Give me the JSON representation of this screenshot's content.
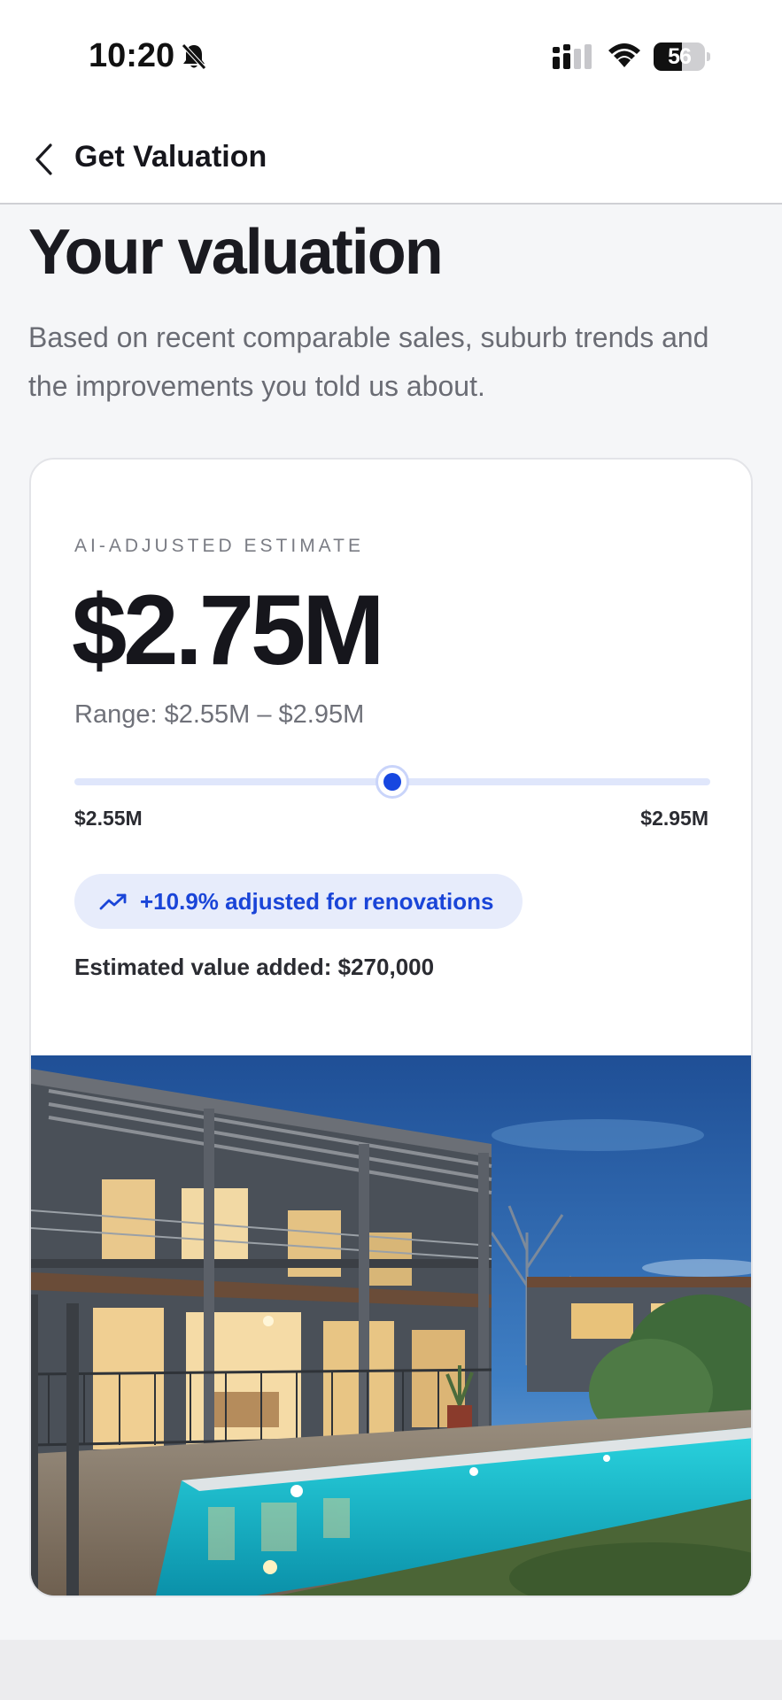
{
  "status_bar": {
    "time": "10:20",
    "battery_level": 56,
    "battery_text": "56",
    "icons": [
      "bell-slash-icon",
      "signal-icon",
      "wifi-icon",
      "battery-icon"
    ]
  },
  "nav": {
    "title": "Get Valuation",
    "back_icon": "chevron-left-icon"
  },
  "header": {
    "title": "Your valuation",
    "subtitle": "Based on recent comparable sales, suburb trends and the improvements you told us about."
  },
  "valuation_card": {
    "label": "AI-ADJUSTED ESTIMATE",
    "value": "$2.75M",
    "range_text": "Range: $2.55M – $2.95M",
    "range": {
      "min_label": "$2.55M",
      "max_label": "$2.95M",
      "min": 2.55,
      "max": 2.95,
      "current": 2.75
    },
    "adjustment": {
      "icon": "trending-up-icon",
      "text": "+10.9% adjusted for renovations"
    },
    "value_added": "Estimated value added: $270,000",
    "image": "house-with-pool-photo"
  },
  "colors": {
    "accent": "#1747e0",
    "badge_bg": "#e7ecfb",
    "page_bg": "#f5f6f8",
    "card_border": "#e3e4e8"
  }
}
